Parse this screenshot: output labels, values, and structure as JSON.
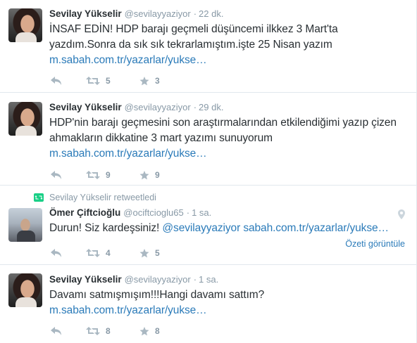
{
  "tweets": [
    {
      "fullname": "Sevilay Yükselir",
      "username": "@sevilayyaziyor",
      "sep": "·",
      "time": "22 dk.",
      "text": "İNSAF EDİN! HDP barajı geçmeli düşüncemi ilkkez 3 Mart'ta yazdım.Sonra da sık sık tekrarlamıştım.işte 25 Nisan yazım",
      "link": "m.sabah.com.tr/yazarlar/yukse…",
      "retweets": "5",
      "favorites": "3"
    },
    {
      "fullname": "Sevilay Yükselir",
      "username": "@sevilayyaziyor",
      "sep": "·",
      "time": "29 dk.",
      "text": "HDP'nin barajı geçmesini son araştırmalarından etkilendiğimi yazıp çizen ahmakların dikkatine 3 mart yazımı sunuyorum",
      "link": "m.sabah.com.tr/yazarlar/yukse…",
      "retweets": "9",
      "favorites": "9"
    },
    {
      "retweet_context": "Sevilay Yükselir retweetledi",
      "fullname": "Ömer Çiftcioğlu",
      "username": "@ociftcioglu65",
      "sep": "·",
      "time": "1 sa.",
      "text": "Durun! Siz kardeşsiniz! ",
      "mention": "@sevilayyaziyor",
      "link": "sabah.com.tr/yazarlar/yukse…",
      "retweets": "4",
      "favorites": "5",
      "summary_label": "Özeti görüntüle"
    },
    {
      "fullname": "Sevilay Yükselir",
      "username": "@sevilayyaziyor",
      "sep": "·",
      "time": "1 sa.",
      "text": "Davamı satmışmışım!!!Hangi davamı sattım?",
      "link": "m.sabah.com.tr/yazarlar/yukse…",
      "retweets": "8",
      "favorites": "8"
    }
  ],
  "icons": {
    "reply": "reply-icon",
    "retweet": "retweet-icon",
    "favorite": "star-icon",
    "geo": "location-pin-icon"
  },
  "colors": {
    "link": "#2b7bb9",
    "muted": "#8899a6",
    "retweet_green": "#19cf86"
  }
}
